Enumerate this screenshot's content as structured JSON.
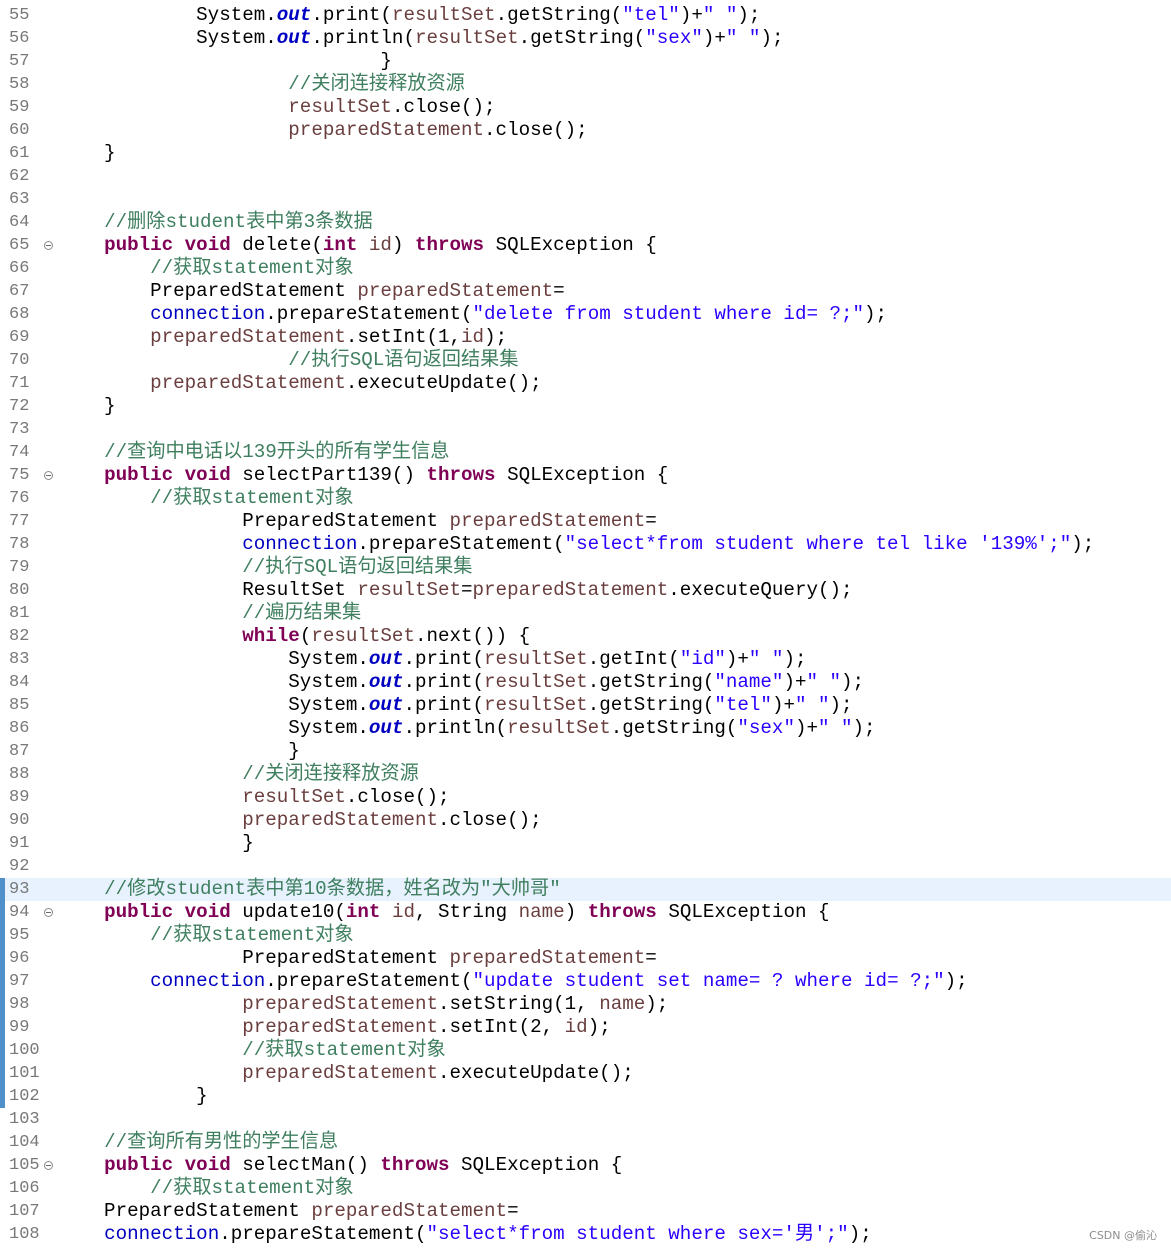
{
  "watermark": "CSDN @偷沁",
  "colors": {
    "keyword": "#7f0055",
    "string": "#2a00ff",
    "comment": "#3f7f5f",
    "variable": "#6a3e3e",
    "field": "#0000c0",
    "current_line": "#e8f2fe",
    "change_marker": "#4f8fca"
  },
  "lines": [
    {
      "n": "55",
      "segs": [
        [
          "plain",
          "            System."
        ],
        [
          "field",
          "out"
        ],
        [
          "plain",
          ".print("
        ],
        [
          "var",
          "resultSet"
        ],
        [
          "plain",
          ".getString("
        ],
        [
          "string",
          "\"tel\""
        ],
        [
          "plain",
          ")+"
        ],
        [
          "string",
          "\" \""
        ],
        [
          "plain",
          ");"
        ]
      ]
    },
    {
      "n": "56",
      "segs": [
        [
          "plain",
          "            System."
        ],
        [
          "field",
          "out"
        ],
        [
          "plain",
          ".println("
        ],
        [
          "var",
          "resultSet"
        ],
        [
          "plain",
          ".getString("
        ],
        [
          "string",
          "\"sex\""
        ],
        [
          "plain",
          ")+"
        ],
        [
          "string",
          "\" \""
        ],
        [
          "plain",
          ");"
        ]
      ]
    },
    {
      "n": "57",
      "segs": [
        [
          "plain",
          "                            }"
        ]
      ]
    },
    {
      "n": "58",
      "segs": [
        [
          "plain",
          "                    "
        ],
        [
          "comment",
          "//关闭连接释放资源"
        ]
      ]
    },
    {
      "n": "59",
      "segs": [
        [
          "plain",
          "                    "
        ],
        [
          "var",
          "resultSet"
        ],
        [
          "plain",
          ".close();"
        ]
      ]
    },
    {
      "n": "60",
      "segs": [
        [
          "plain",
          "                    "
        ],
        [
          "var",
          "preparedStatement"
        ],
        [
          "plain",
          ".close();"
        ]
      ]
    },
    {
      "n": "61",
      "segs": [
        [
          "plain",
          "    }"
        ]
      ]
    },
    {
      "n": "62",
      "segs": []
    },
    {
      "n": "63",
      "segs": []
    },
    {
      "n": "64",
      "segs": [
        [
          "plain",
          "    "
        ],
        [
          "comment",
          "//删除student表中第3条数据"
        ]
      ]
    },
    {
      "n": "65",
      "fold": true,
      "segs": [
        [
          "plain",
          "    "
        ],
        [
          "keyword",
          "public"
        ],
        [
          "plain",
          " "
        ],
        [
          "keyword",
          "void"
        ],
        [
          "plain",
          " delete("
        ],
        [
          "keyword",
          "int"
        ],
        [
          "plain",
          " "
        ],
        [
          "var",
          "id"
        ],
        [
          "plain",
          ") "
        ],
        [
          "keyword",
          "throws"
        ],
        [
          "plain",
          " SQLException {"
        ]
      ]
    },
    {
      "n": "66",
      "segs": [
        [
          "plain",
          "        "
        ],
        [
          "comment",
          "//获取statement对象"
        ]
      ]
    },
    {
      "n": "67",
      "segs": [
        [
          "plain",
          "        PreparedStatement "
        ],
        [
          "var",
          "preparedStatement"
        ],
        [
          "plain",
          "="
        ]
      ]
    },
    {
      "n": "68",
      "segs": [
        [
          "plain",
          "        "
        ],
        [
          "field2",
          "connection"
        ],
        [
          "plain",
          ".prepareStatement("
        ],
        [
          "string",
          "\"delete from student where id= ?;\""
        ],
        [
          "plain",
          ");"
        ]
      ]
    },
    {
      "n": "69",
      "segs": [
        [
          "plain",
          "        "
        ],
        [
          "var",
          "preparedStatement"
        ],
        [
          "plain",
          ".setInt(1,"
        ],
        [
          "var",
          "id"
        ],
        [
          "plain",
          ");"
        ]
      ]
    },
    {
      "n": "70",
      "segs": [
        [
          "plain",
          "                    "
        ],
        [
          "comment",
          "//执行SQL语句返回结果集"
        ]
      ]
    },
    {
      "n": "71",
      "segs": [
        [
          "plain",
          "        "
        ],
        [
          "var",
          "preparedStatement"
        ],
        [
          "plain",
          ".executeUpdate();"
        ]
      ]
    },
    {
      "n": "72",
      "segs": [
        [
          "plain",
          "    }"
        ]
      ]
    },
    {
      "n": "73",
      "segs": []
    },
    {
      "n": "74",
      "segs": [
        [
          "plain",
          "    "
        ],
        [
          "comment",
          "//查询中电话以139开头的所有学生信息"
        ]
      ]
    },
    {
      "n": "75",
      "fold": true,
      "segs": [
        [
          "plain",
          "    "
        ],
        [
          "keyword",
          "public"
        ],
        [
          "plain",
          " "
        ],
        [
          "keyword",
          "void"
        ],
        [
          "plain",
          " selectPart139() "
        ],
        [
          "keyword",
          "throws"
        ],
        [
          "plain",
          " SQLException {"
        ]
      ]
    },
    {
      "n": "76",
      "segs": [
        [
          "plain",
          "        "
        ],
        [
          "comment",
          "//获取statement对象"
        ]
      ]
    },
    {
      "n": "77",
      "segs": [
        [
          "plain",
          "                PreparedStatement "
        ],
        [
          "var",
          "preparedStatement"
        ],
        [
          "plain",
          "="
        ]
      ]
    },
    {
      "n": "78",
      "segs": [
        [
          "plain",
          "                "
        ],
        [
          "field2",
          "connection"
        ],
        [
          "plain",
          ".prepareStatement("
        ],
        [
          "string",
          "\"select*from student where tel like '139%';\""
        ],
        [
          "plain",
          ");"
        ]
      ]
    },
    {
      "n": "79",
      "segs": [
        [
          "plain",
          "                "
        ],
        [
          "comment",
          "//执行SQL语句返回结果集"
        ]
      ]
    },
    {
      "n": "80",
      "segs": [
        [
          "plain",
          "                ResultSet "
        ],
        [
          "var",
          "resultSet"
        ],
        [
          "plain",
          "="
        ],
        [
          "var",
          "preparedStatement"
        ],
        [
          "plain",
          ".executeQuery();"
        ]
      ]
    },
    {
      "n": "81",
      "segs": [
        [
          "plain",
          "                "
        ],
        [
          "comment",
          "//遍历结果集"
        ]
      ]
    },
    {
      "n": "82",
      "segs": [
        [
          "plain",
          "                "
        ],
        [
          "keyword",
          "while"
        ],
        [
          "plain",
          "("
        ],
        [
          "var",
          "resultSet"
        ],
        [
          "plain",
          ".next()) {"
        ]
      ]
    },
    {
      "n": "83",
      "segs": [
        [
          "plain",
          "                    System."
        ],
        [
          "field",
          "out"
        ],
        [
          "plain",
          ".print("
        ],
        [
          "var",
          "resultSet"
        ],
        [
          "plain",
          ".getInt("
        ],
        [
          "string",
          "\"id\""
        ],
        [
          "plain",
          ")+"
        ],
        [
          "string",
          "\" \""
        ],
        [
          "plain",
          ");"
        ]
      ]
    },
    {
      "n": "84",
      "segs": [
        [
          "plain",
          "                    System."
        ],
        [
          "field",
          "out"
        ],
        [
          "plain",
          ".print("
        ],
        [
          "var",
          "resultSet"
        ],
        [
          "plain",
          ".getString("
        ],
        [
          "string",
          "\"name\""
        ],
        [
          "plain",
          ")+"
        ],
        [
          "string",
          "\" \""
        ],
        [
          "plain",
          ");"
        ]
      ]
    },
    {
      "n": "85",
      "segs": [
        [
          "plain",
          "                    System."
        ],
        [
          "field",
          "out"
        ],
        [
          "plain",
          ".print("
        ],
        [
          "var",
          "resultSet"
        ],
        [
          "plain",
          ".getString("
        ],
        [
          "string",
          "\"tel\""
        ],
        [
          "plain",
          ")+"
        ],
        [
          "string",
          "\" \""
        ],
        [
          "plain",
          ");"
        ]
      ]
    },
    {
      "n": "86",
      "segs": [
        [
          "plain",
          "                    System."
        ],
        [
          "field",
          "out"
        ],
        [
          "plain",
          ".println("
        ],
        [
          "var",
          "resultSet"
        ],
        [
          "plain",
          ".getString("
        ],
        [
          "string",
          "\"sex\""
        ],
        [
          "plain",
          ")+"
        ],
        [
          "string",
          "\" \""
        ],
        [
          "plain",
          ");"
        ]
      ]
    },
    {
      "n": "87",
      "segs": [
        [
          "plain",
          "                    }"
        ]
      ]
    },
    {
      "n": "88",
      "segs": [
        [
          "plain",
          "                "
        ],
        [
          "comment",
          "//关闭连接释放资源"
        ]
      ]
    },
    {
      "n": "89",
      "segs": [
        [
          "plain",
          "                "
        ],
        [
          "var",
          "resultSet"
        ],
        [
          "plain",
          ".close();"
        ]
      ]
    },
    {
      "n": "90",
      "segs": [
        [
          "plain",
          "                "
        ],
        [
          "var",
          "preparedStatement"
        ],
        [
          "plain",
          ".close();"
        ]
      ]
    },
    {
      "n": "91",
      "segs": [
        [
          "plain",
          "                }"
        ]
      ]
    },
    {
      "n": "92",
      "segs": []
    },
    {
      "n": "93",
      "current": true,
      "changed": true,
      "segs": [
        [
          "plain",
          "    "
        ],
        [
          "comment",
          "//修改student表中第10条数据，姓名改为\"大帅哥\""
        ]
      ]
    },
    {
      "n": "94",
      "fold": true,
      "changed": true,
      "segs": [
        [
          "plain",
          "    "
        ],
        [
          "keyword",
          "public"
        ],
        [
          "plain",
          " "
        ],
        [
          "keyword",
          "void"
        ],
        [
          "plain",
          " update10("
        ],
        [
          "keyword",
          "int"
        ],
        [
          "plain",
          " "
        ],
        [
          "var",
          "id"
        ],
        [
          "plain",
          ", String "
        ],
        [
          "var",
          "name"
        ],
        [
          "plain",
          ") "
        ],
        [
          "keyword",
          "throws"
        ],
        [
          "plain",
          " SQLException {"
        ]
      ]
    },
    {
      "n": "95",
      "changed": true,
      "segs": [
        [
          "plain",
          "        "
        ],
        [
          "comment",
          "//获取statement对象"
        ]
      ]
    },
    {
      "n": "96",
      "changed": true,
      "segs": [
        [
          "plain",
          "                PreparedStatement "
        ],
        [
          "var",
          "preparedStatement"
        ],
        [
          "plain",
          "="
        ]
      ]
    },
    {
      "n": "97",
      "changed": true,
      "segs": [
        [
          "plain",
          "        "
        ],
        [
          "field2",
          "connection"
        ],
        [
          "plain",
          ".prepareStatement("
        ],
        [
          "string",
          "\"update student set name= ? where id= ?;\""
        ],
        [
          "plain",
          ");"
        ]
      ]
    },
    {
      "n": "98",
      "changed": true,
      "segs": [
        [
          "plain",
          "                "
        ],
        [
          "var",
          "preparedStatement"
        ],
        [
          "plain",
          ".setString(1, "
        ],
        [
          "var",
          "name"
        ],
        [
          "plain",
          ");"
        ]
      ]
    },
    {
      "n": "99",
      "changed": true,
      "segs": [
        [
          "plain",
          "                "
        ],
        [
          "var",
          "preparedStatement"
        ],
        [
          "plain",
          ".setInt(2, "
        ],
        [
          "var",
          "id"
        ],
        [
          "plain",
          ");"
        ]
      ]
    },
    {
      "n": "100",
      "changed": true,
      "segs": [
        [
          "plain",
          "                "
        ],
        [
          "comment",
          "//获取statement对象"
        ]
      ]
    },
    {
      "n": "101",
      "changed": true,
      "segs": [
        [
          "plain",
          "                "
        ],
        [
          "var",
          "preparedStatement"
        ],
        [
          "plain",
          ".executeUpdate();"
        ]
      ]
    },
    {
      "n": "102",
      "changed": true,
      "segs": [
        [
          "plain",
          "            }"
        ]
      ]
    },
    {
      "n": "103",
      "segs": []
    },
    {
      "n": "104",
      "segs": [
        [
          "plain",
          "    "
        ],
        [
          "comment",
          "//查询所有男性的学生信息"
        ]
      ]
    },
    {
      "n": "105",
      "fold": true,
      "segs": [
        [
          "plain",
          "    "
        ],
        [
          "keyword",
          "public"
        ],
        [
          "plain",
          " "
        ],
        [
          "keyword",
          "void"
        ],
        [
          "plain",
          " selectMan() "
        ],
        [
          "keyword",
          "throws"
        ],
        [
          "plain",
          " SQLException {"
        ]
      ]
    },
    {
      "n": "106",
      "segs": [
        [
          "plain",
          "        "
        ],
        [
          "comment",
          "//获取statement对象"
        ]
      ]
    },
    {
      "n": "107",
      "segs": [
        [
          "plain",
          "    PreparedStatement "
        ],
        [
          "var",
          "preparedStatement"
        ],
        [
          "plain",
          "="
        ]
      ]
    },
    {
      "n": "108",
      "segs": [
        [
          "plain",
          "    "
        ],
        [
          "field2",
          "connection"
        ],
        [
          "plain",
          ".prepareStatement("
        ],
        [
          "string",
          "\"select*from student where sex='男';\""
        ],
        [
          "plain",
          ");"
        ]
      ]
    }
  ]
}
